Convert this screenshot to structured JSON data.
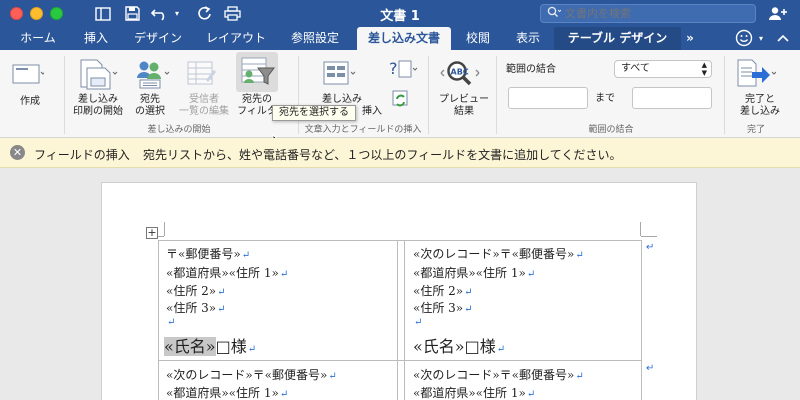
{
  "window": {
    "title": "文書 1",
    "search_placeholder": "文書内を検索"
  },
  "tabs": [
    {
      "label": "ホーム"
    },
    {
      "label": "挿入"
    },
    {
      "label": "デザイン"
    },
    {
      "label": "レイアウト"
    },
    {
      "label": "参照設定"
    },
    {
      "label": "差し込み文書"
    },
    {
      "label": "校閲"
    },
    {
      "label": "表示"
    },
    {
      "label": "テーブル デザイン"
    }
  ],
  "tab_overflow": "»",
  "ribbon": {
    "create": "作成",
    "start_merge_l1": "差し込み",
    "start_merge_l2": "印刷の開始",
    "select_recipients_l1": "宛先",
    "select_recipients_l2": "の選択",
    "edit_list_l1": "受信者",
    "edit_list_l2": "一覧の編集",
    "filter_l1": "宛先の",
    "filter_l2": "フィルタ",
    "group_start": "差し込みの開始",
    "insert_field_l1": "差し込み",
    "insert_field_l2": "挿入",
    "group_fields": "文章入力とフィールドの挿入",
    "preview_l1": "プレビュー",
    "preview_l2": "結果",
    "range_label": "範囲の結合",
    "range_value": "すべて",
    "range_to": "まで",
    "group_range": "範囲の結合",
    "finish_l1": "完了と",
    "finish_l2": "差し込み",
    "group_finish": "完了"
  },
  "tooltip": "宛先を選択する",
  "message_bar": {
    "title": "フィールドの挿入",
    "text": "宛先リストから、姓や電話番号など、１つ以上のフィールドを文書に追加してください。"
  },
  "document": {
    "postal": "〒«郵便番号»",
    "next_postal": "«次のレコード»〒«郵便番号»",
    "prefecture_addr1": "«都道府県»«住所 1»",
    "addr2": "«住所 2»",
    "addr3": "«住所 3»",
    "name_field": "«氏名»",
    "honorific": "□様",
    "para_mark": "↵"
  },
  "colors": {
    "brand": "#2b579a",
    "message_bg": "#fcf6d6",
    "paragraph_mark": "#2b6fd6"
  }
}
